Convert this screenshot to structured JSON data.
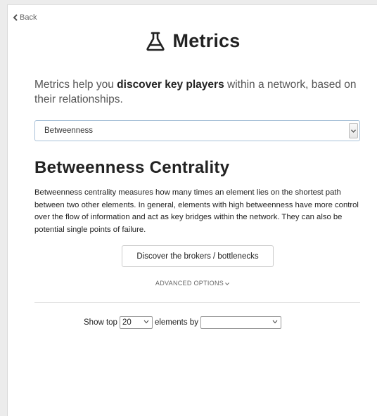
{
  "nav": {
    "back_label": "Back"
  },
  "header": {
    "title": "Metrics",
    "icon": "flask-icon"
  },
  "intro": {
    "prefix": "Metrics help you ",
    "emphasis": "discover key players",
    "suffix": " within a network, based on their relationships."
  },
  "metric_select": {
    "selected": "Betweenness"
  },
  "section": {
    "title": "Betweenness Centrality",
    "description": "Betweenness centrality measures how many times an element lies on the shortest path between two other elements. In general, elements with high betweenness have more control over the flow of information and act as key bridges within the network. They can also be potential single points of failure.",
    "action_label": "Discover the brokers / bottlenecks"
  },
  "advanced": {
    "label": "ADVANCED OPTIONS"
  },
  "show_top": {
    "prefix": "Show top",
    "count": "20",
    "middle": "elements by",
    "by_value": ""
  },
  "colors": {
    "select_border": "#a9c2d8",
    "panel_bg": "#ffffff",
    "page_bg": "#ececec"
  }
}
